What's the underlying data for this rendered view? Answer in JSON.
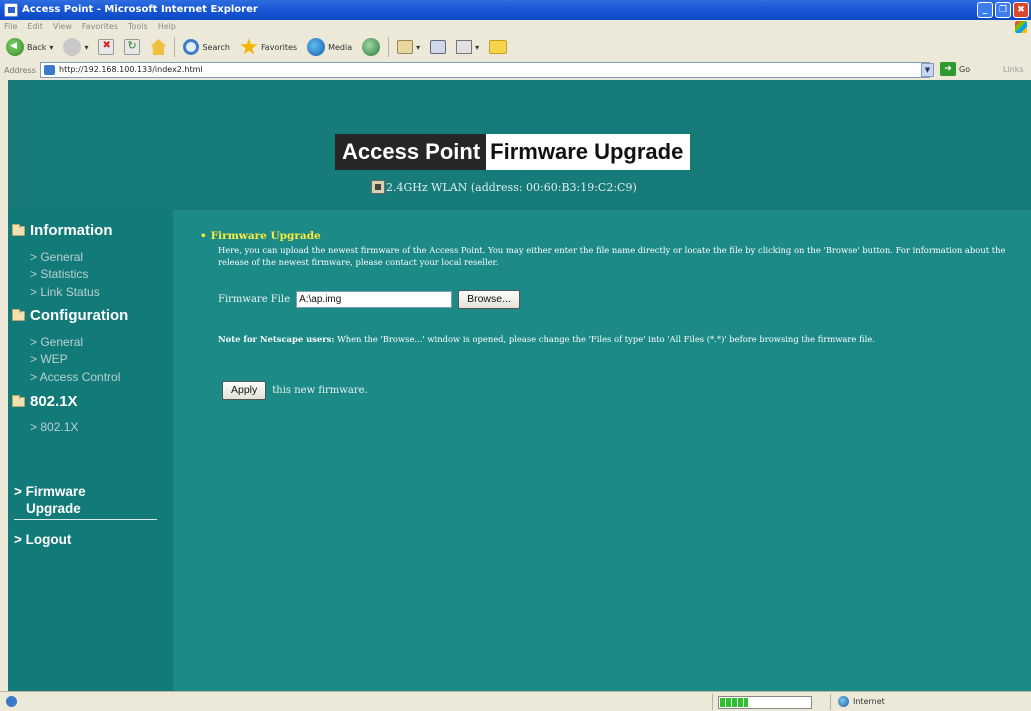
{
  "window": {
    "title": "Access Point - Microsoft Internet Explorer",
    "controls": {
      "minimize": "_",
      "restore": "❐",
      "close": "✖"
    }
  },
  "menu": [
    "File",
    "Edit",
    "View",
    "Favorites",
    "Tools",
    "Help"
  ],
  "toolbar": {
    "back_label": "Back",
    "search_label": "Search",
    "favorites_label": "Favorites",
    "media_label": "Media"
  },
  "address": {
    "label": "Address",
    "url": "http://192.168.100.133/index2.html",
    "go_label": "Go",
    "links_label": "Links"
  },
  "header": {
    "title_part1": "Access Point",
    "title_part2": "Firmware Upgrade",
    "wlan_info": "2.4GHz WLAN (address: 00:60:B3:19:C2:C9)"
  },
  "sidebar": {
    "sections": [
      {
        "label": "Information",
        "items": [
          "> General",
          "> Statistics",
          "> Link Status"
        ]
      },
      {
        "label": "Configuration",
        "items": [
          "> General",
          "> WEP",
          "> Access Control"
        ]
      },
      {
        "label": "802.1X",
        "items": [
          "> 802.1X"
        ]
      }
    ],
    "firmware_link_line1": "> Firmware",
    "firmware_link_line2": "Upgrade",
    "logout_link": "> Logout"
  },
  "main": {
    "bullet": "•",
    "heading": "Firmware Upgrade",
    "description": "Here, you can upload the newest firmware of the Access Point. You may either enter the file name directly or locate the file by clicking on the 'Browse' button. For information about the release of the newest firmware, please contact your local reseller.",
    "firmware_file_label": "Firmware File",
    "firmware_file_value": "A:\\ap.img",
    "browse_label": "Browse...",
    "note_bold": "Note for Netscape users:",
    "note_text": " When the 'Browse...' window is opened, please change the 'Files of type' into 'All Files (*.*)' before browsing the firmware file.",
    "apply_label": "Apply",
    "apply_suffix": "this new firmware."
  },
  "status": {
    "zone_label": "Internet",
    "progress_fraction": 0.3
  },
  "colors": {
    "page_bg": "#127a78",
    "main_bg": "#1c8a87",
    "heading_yellow": "#ffeb3b"
  }
}
